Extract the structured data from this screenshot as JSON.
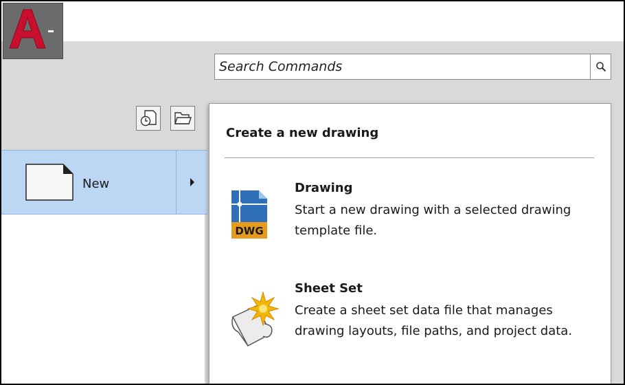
{
  "app_menu": {
    "icon": "autocad-a-logo",
    "dropdown_icon": "caret-down-icon",
    "accent_color": "#c8102e"
  },
  "search": {
    "placeholder": "Search Commands",
    "icon": "magnifier-icon"
  },
  "toolbar": {
    "recent_icon": "recent-documents-icon",
    "open_icon": "open-folder-icon"
  },
  "menu": {
    "new_label": "New",
    "new_icon": "blank-document-icon",
    "submenu_icon": "chevron-right-icon",
    "highlight_color": "#bcd7f3"
  },
  "flyout": {
    "heading": "Create a new drawing",
    "options": [
      {
        "title": "Drawing",
        "description": "Start a new drawing with a selected drawing template file.",
        "icon": "dwg-file-icon",
        "icon_text": "DWG"
      },
      {
        "title": "Sheet Set",
        "description": "Create a sheet set data file that manages drawing layouts, file paths, and project data.",
        "icon": "sheet-set-icon"
      }
    ]
  }
}
